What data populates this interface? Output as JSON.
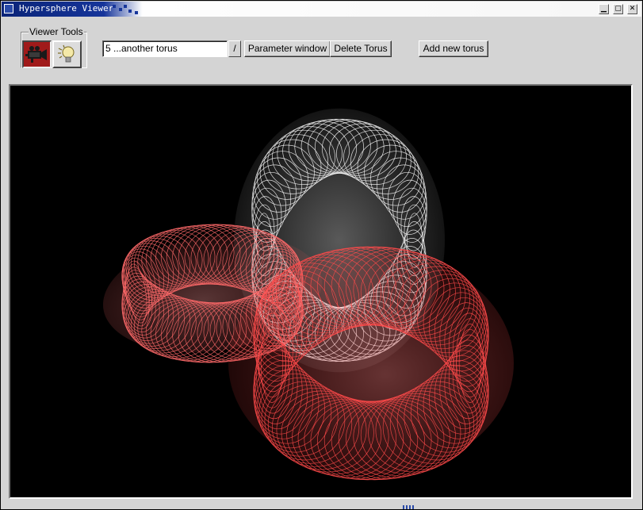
{
  "window": {
    "title": "Hypersphere Viewer",
    "controls": {
      "minimize": "▁",
      "maximize": "▢",
      "close": "✕"
    }
  },
  "toolbar": {
    "group_label": "Viewer Tools",
    "tools": [
      {
        "name": "camera-tool",
        "icon": "video-camera-icon",
        "active": true
      },
      {
        "name": "light-tool",
        "icon": "light-bulb-icon",
        "active": false
      }
    ],
    "torus_select": {
      "value": "5 ...another torus",
      "arrow": "/"
    },
    "parameter_button": "Parameter window",
    "delete_button": "Delete Torus",
    "add_button": "Add new torus"
  },
  "scene": {
    "background": "#000000",
    "objects": [
      {
        "name": "white-torus",
        "color": "#ffffff"
      },
      {
        "name": "left-red-torus",
        "color": "#ff6a6a"
      },
      {
        "name": "front-red-torus",
        "color": "#ff4a4a"
      }
    ]
  }
}
